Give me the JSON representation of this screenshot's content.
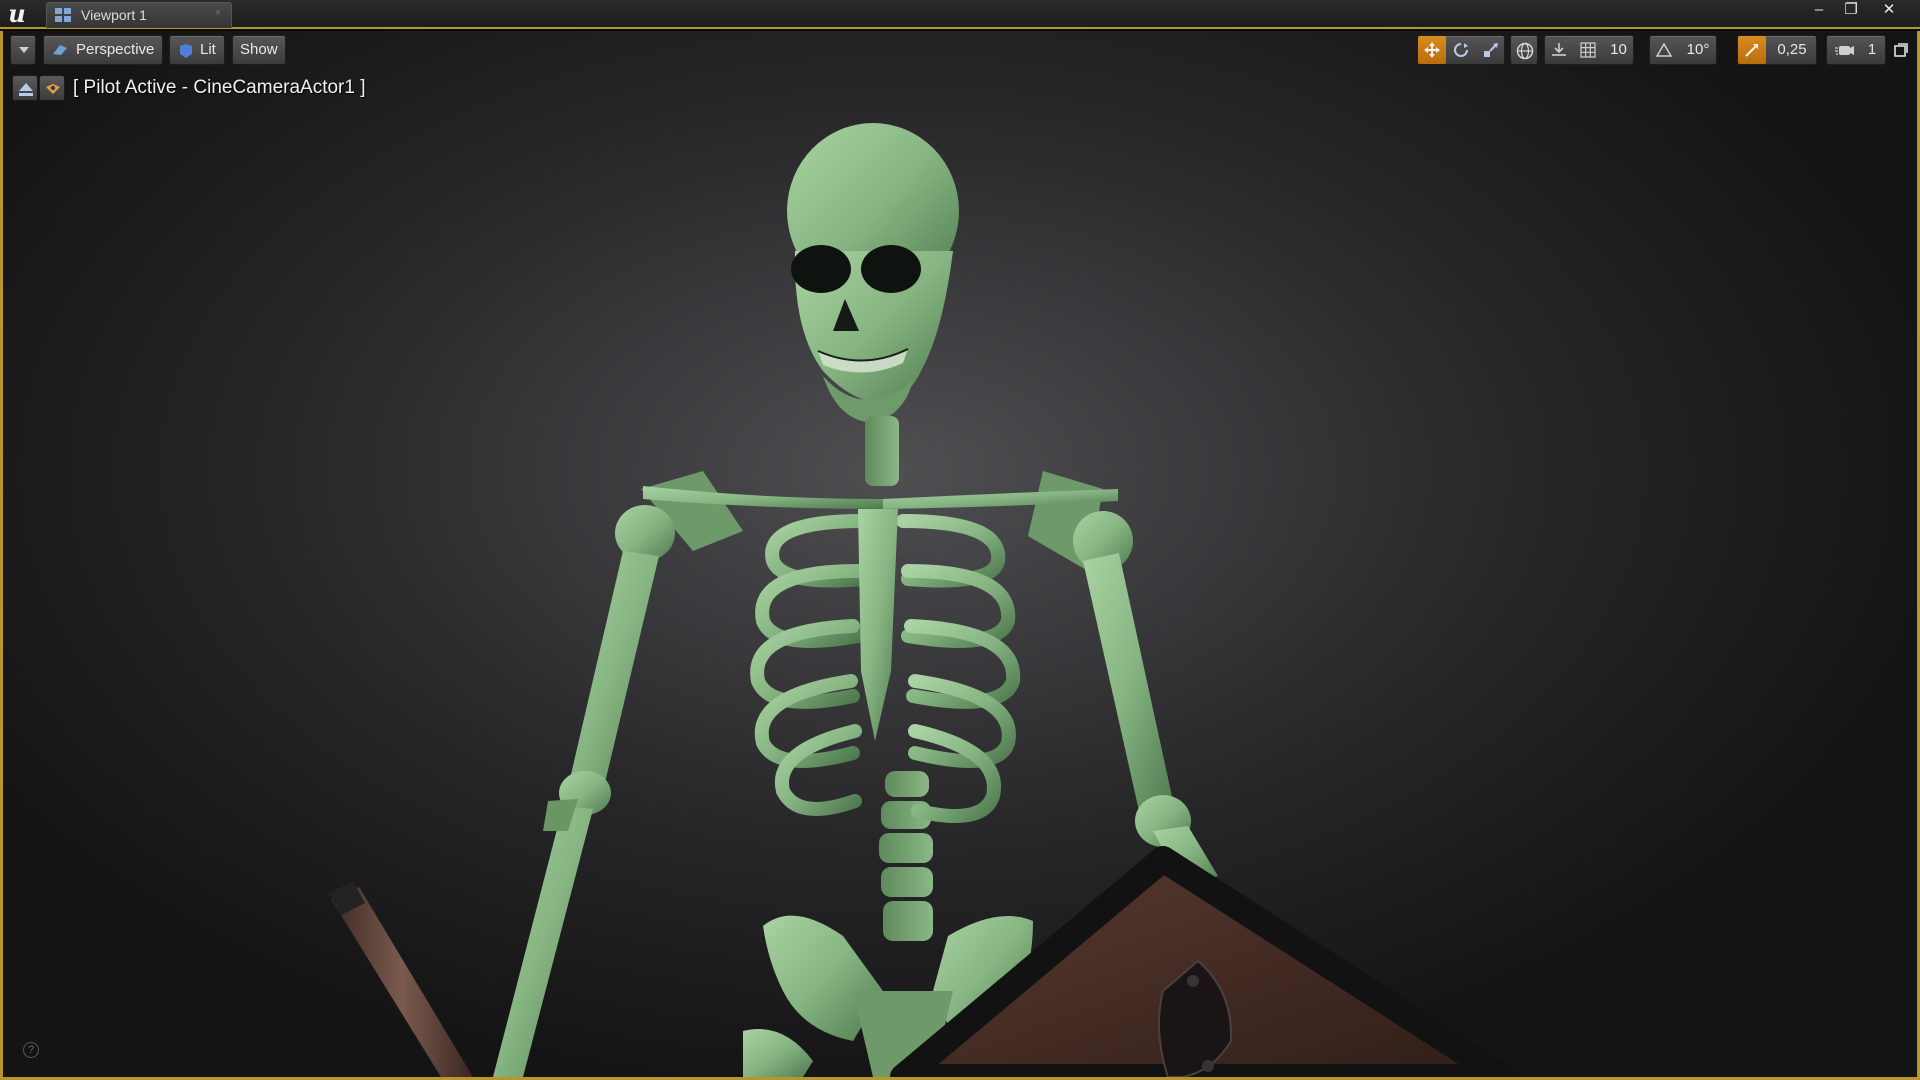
{
  "window": {
    "tab_title": "Viewport 1",
    "minimize_glyph": "–",
    "restore_glyph": "❐",
    "close_glyph": "✕"
  },
  "toolbar": {
    "options_menu_icon": "chevron-down-icon",
    "perspective_label": "Perspective",
    "lit_label": "Lit",
    "show_label": "Show",
    "grid_snap_value": "10",
    "rotation_snap_value": "10°",
    "scale_snap_value": "0,25",
    "camera_speed_value": "1",
    "accent_color": "#c97c12"
  },
  "pilot": {
    "label": "[ Pilot Active - CineCameraActor1 ]",
    "eject_icon": "eject-icon",
    "lock_icon": "camera-lock-icon"
  },
  "scene": {
    "subject": "skeleton",
    "bone_color": "#8fbf8a",
    "background_color": "#3a3a3d"
  },
  "help_glyph": "?"
}
